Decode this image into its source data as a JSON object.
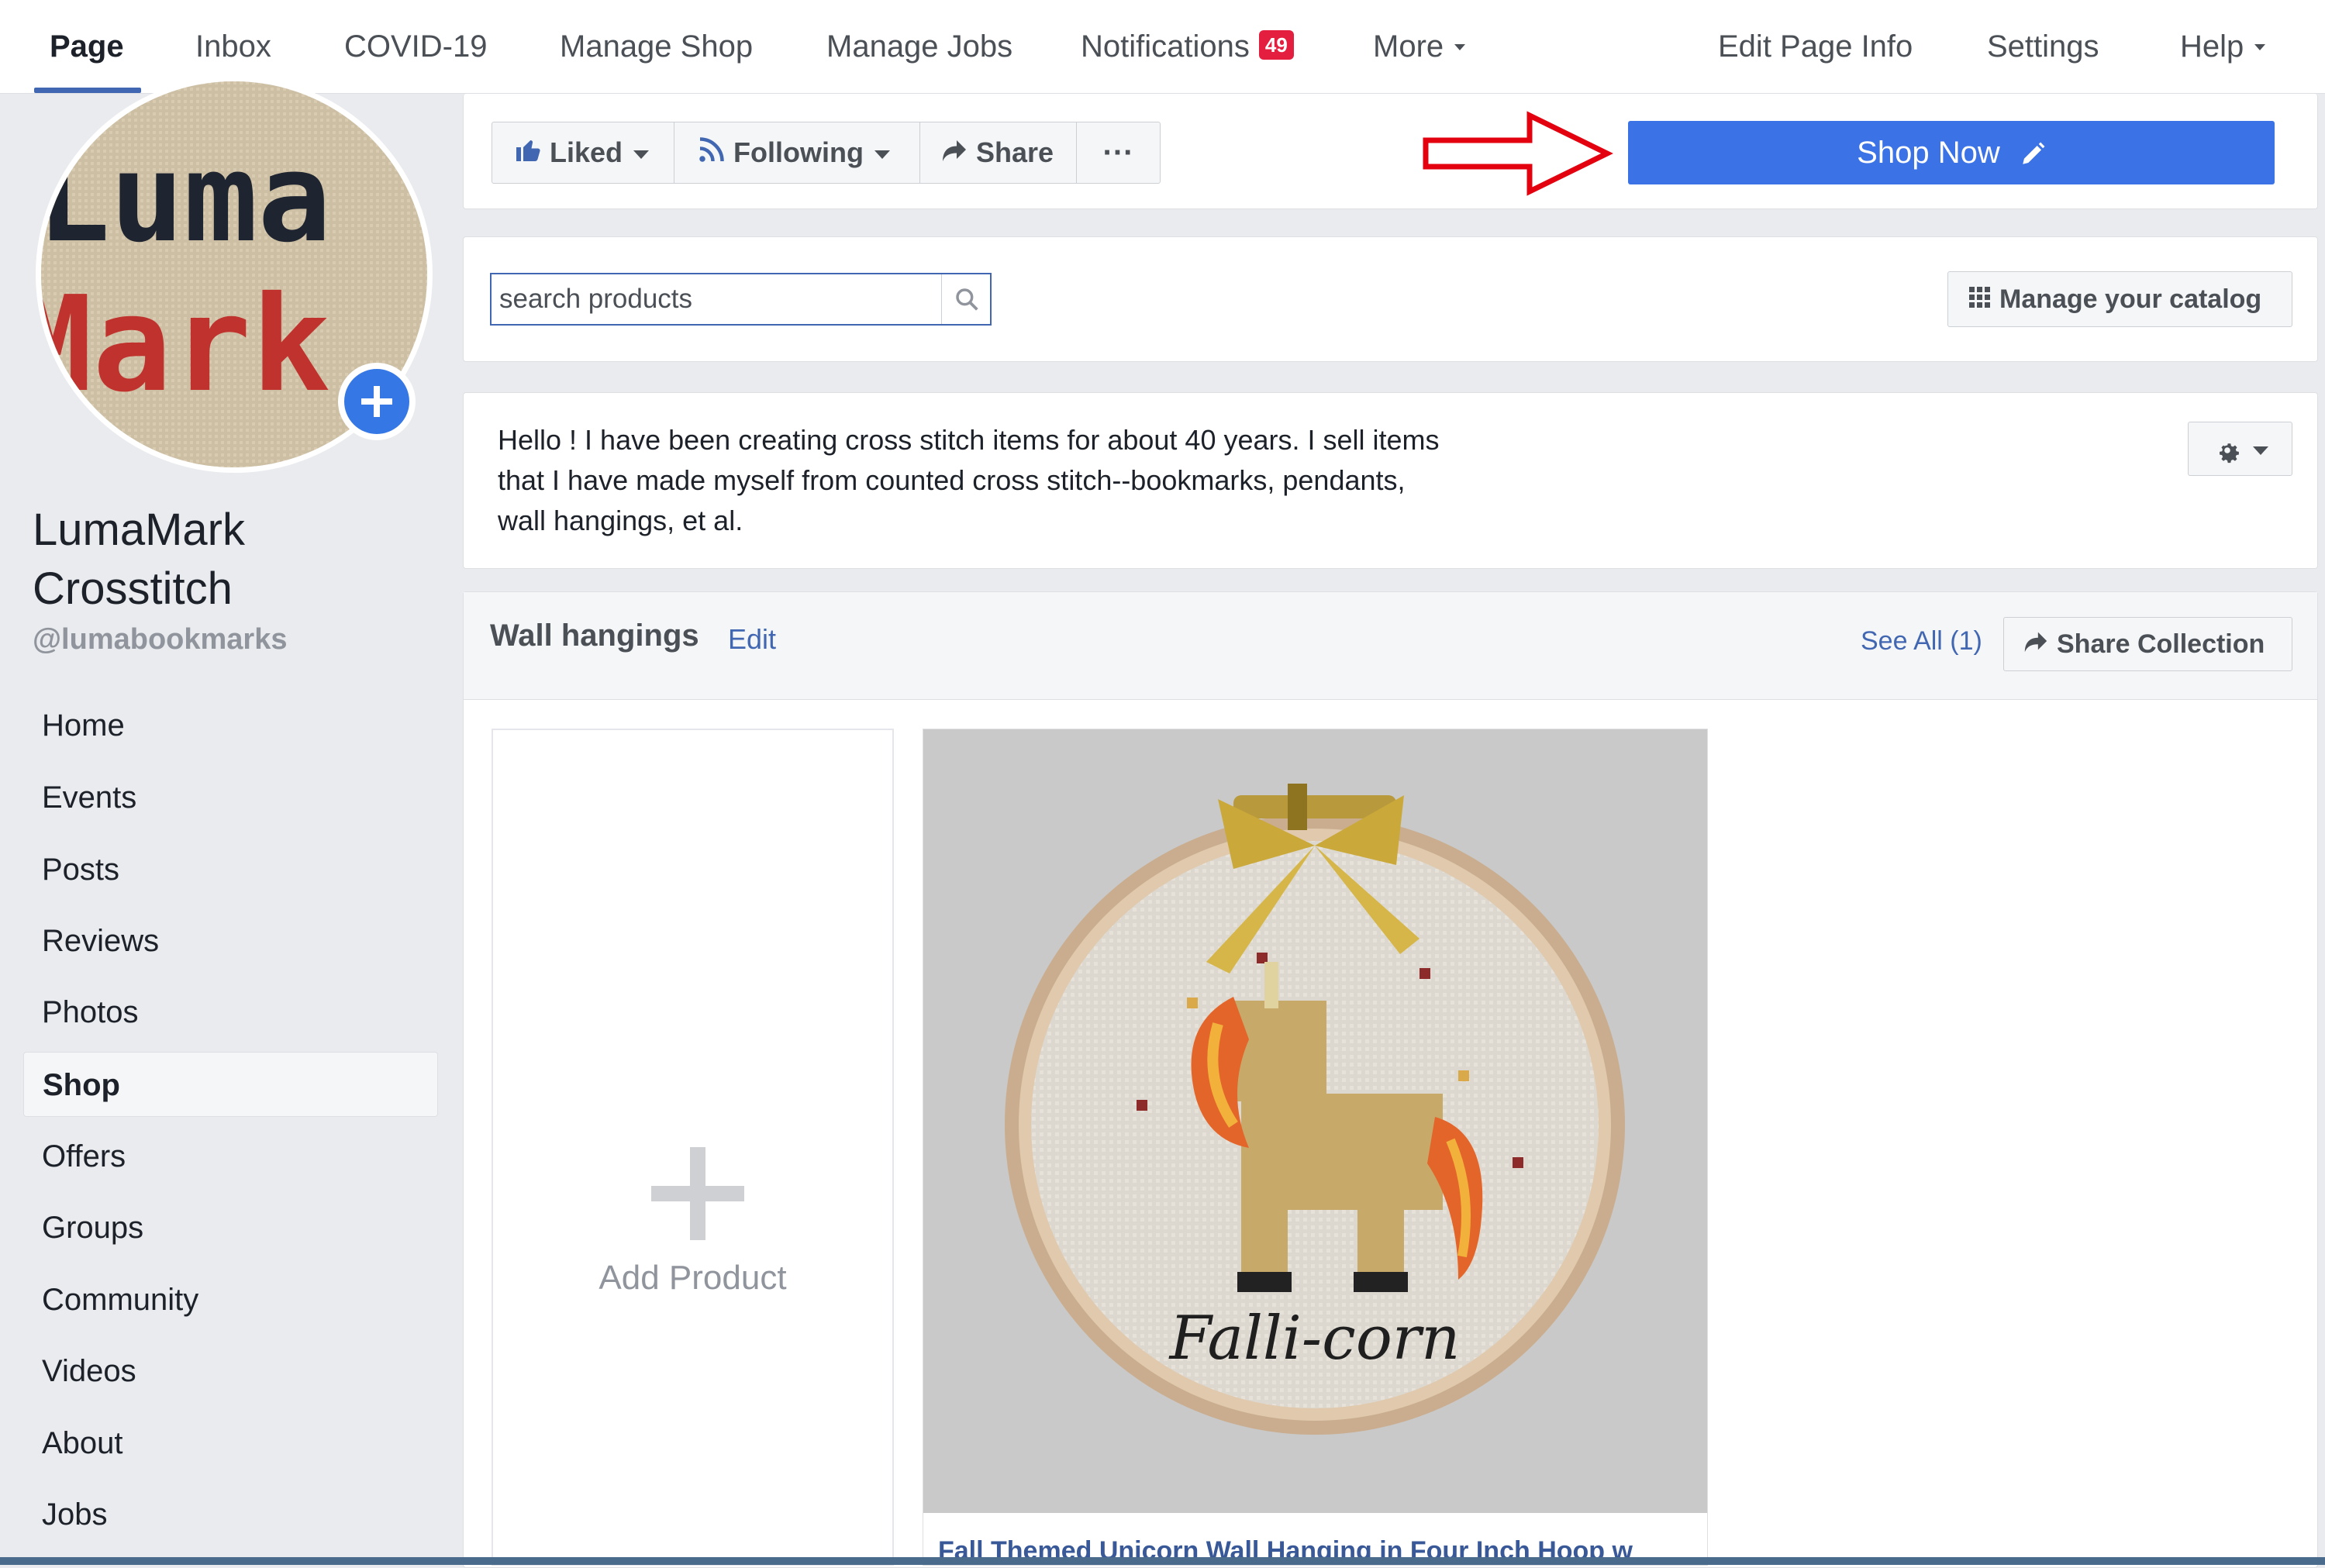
{
  "tabs": [
    {
      "label": "Page",
      "active": true
    },
    {
      "label": "Inbox"
    },
    {
      "label": "COVID-19"
    },
    {
      "label": "Manage Shop"
    },
    {
      "label": "Manage Jobs"
    },
    {
      "label": "Notifications",
      "badge": "49"
    },
    {
      "label": "More"
    },
    {
      "label": "Edit Page Info"
    },
    {
      "label": "Settings"
    },
    {
      "label": "Help"
    }
  ],
  "profile": {
    "logo_text_line1": "Luma",
    "logo_text_line2": "Mark",
    "name_line1": "LumaMark",
    "name_line2": "Crosstitch",
    "handle": "@lumabookmarks"
  },
  "sidebar": {
    "items": [
      {
        "label": "Home"
      },
      {
        "label": "Events"
      },
      {
        "label": "Posts"
      },
      {
        "label": "Reviews"
      },
      {
        "label": "Photos"
      },
      {
        "label": "Shop",
        "active": true
      },
      {
        "label": "Offers"
      },
      {
        "label": "Groups"
      },
      {
        "label": "Community"
      },
      {
        "label": "Videos"
      },
      {
        "label": "About"
      },
      {
        "label": "Jobs"
      }
    ]
  },
  "actions": {
    "liked": "Liked",
    "following": "Following",
    "share": "Share",
    "more": "···",
    "shop_now": "Shop Now"
  },
  "search": {
    "placeholder": "search products",
    "manage_catalog": "Manage your catalog"
  },
  "about": {
    "lines": [
      "Hello ! I have been creating cross stitch items for about 40 years. I sell items",
      "that I have made myself from counted cross stitch--bookmarks, pendants,",
      "wall hangings, et al."
    ]
  },
  "collection": {
    "title": "Wall hangings",
    "edit": "Edit",
    "see_all": "See All (1)",
    "share": "Share Collection",
    "add_product": "Add Product",
    "product_image_text": "Falli-corn",
    "product_title": "Fall Themed Unicorn Wall Hanging in Four Inch Hoop w"
  },
  "colors": {
    "brand_blue": "#4267b2",
    "shop_now_blue": "#3b72e6",
    "badge_red": "#e41e3f",
    "annotation_arrow": "#e3000f"
  }
}
